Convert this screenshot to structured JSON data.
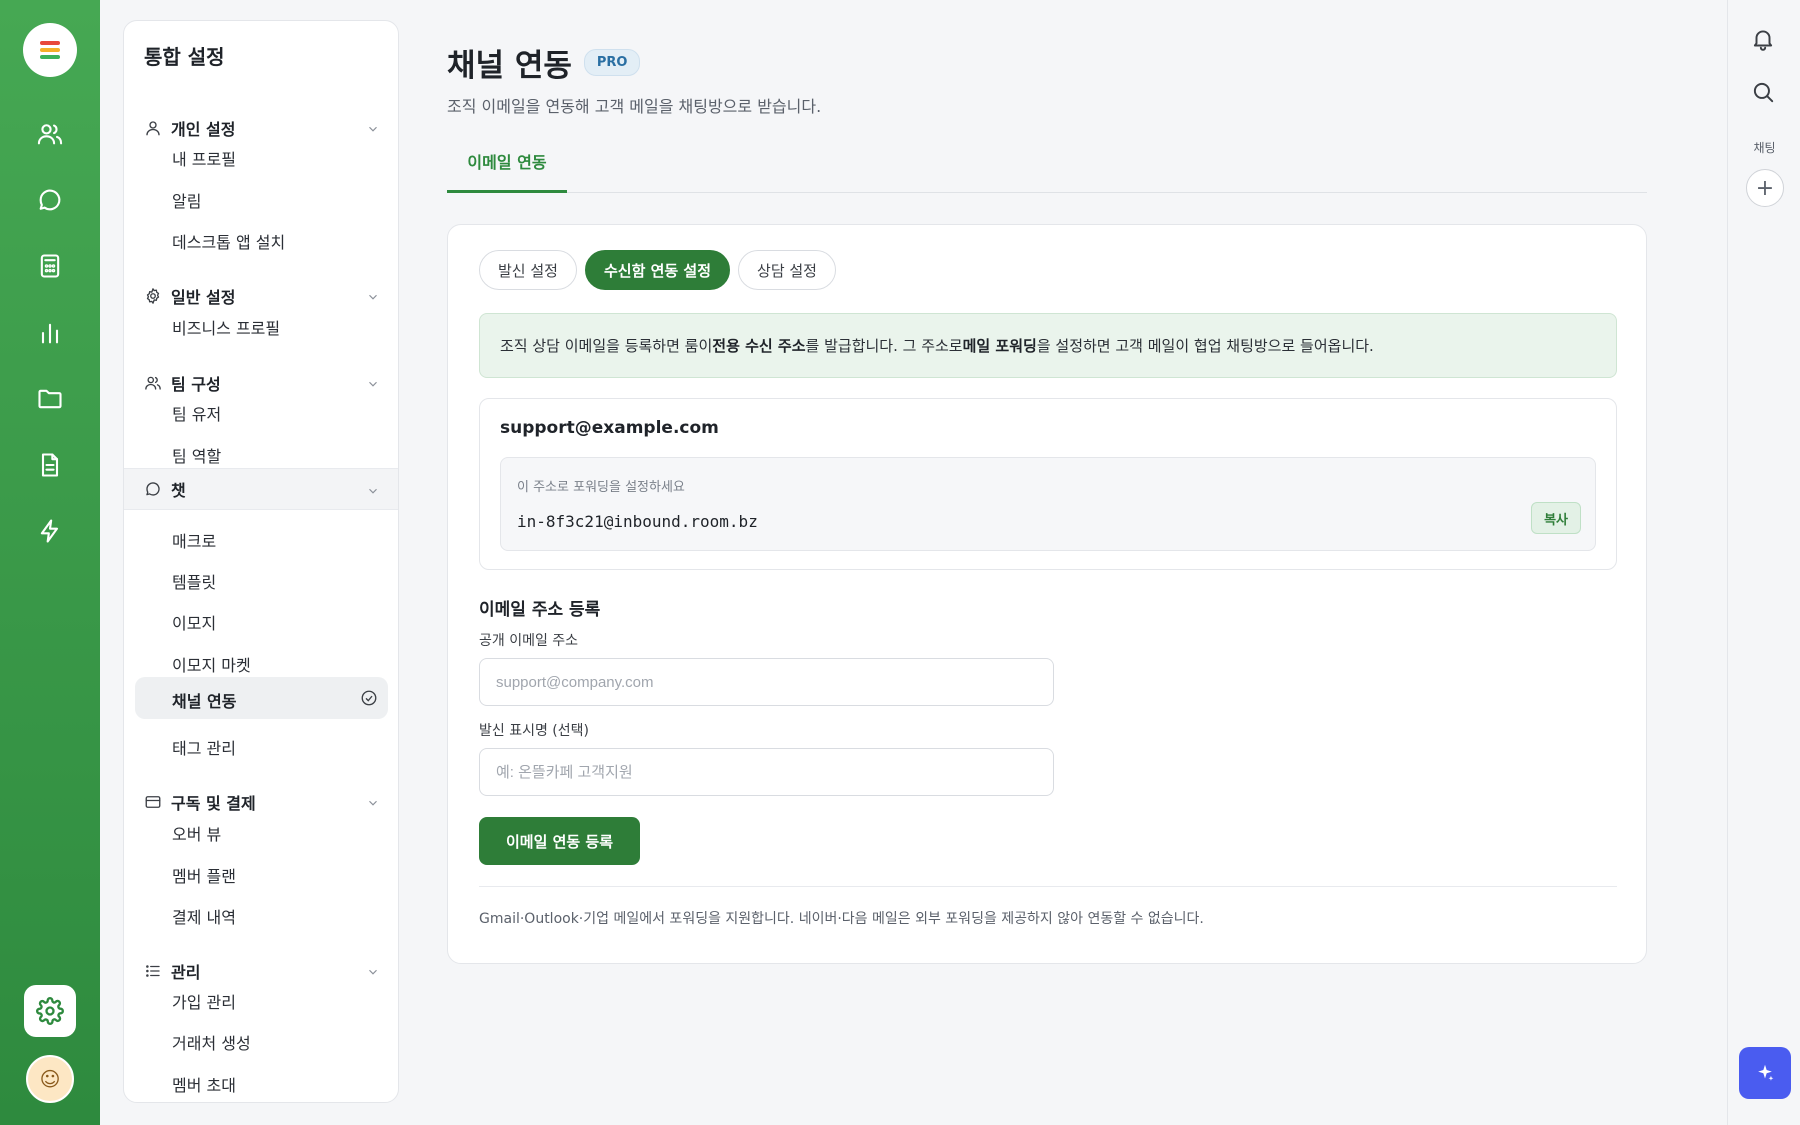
{
  "brand": {
    "accent": "#2e7d38",
    "rail_top": "#46a853",
    "rail_bottom": "#2e8a3e",
    "logo_bars": [
      "#e8483b",
      "#f4b02a",
      "#3bb15a"
    ]
  },
  "rail": {
    "icons": [
      "users-icon",
      "chat-icon",
      "calculator-icon",
      "bar-chart-icon",
      "folder-icon",
      "document-icon",
      "lightning-icon"
    ],
    "settings": "gear-icon",
    "avatar": "☺"
  },
  "sidebar": {
    "title": "통합 설정",
    "groups": [
      {
        "label": "개인 설정",
        "icon": "user-icon",
        "items": [
          "내 프로필",
          "알림",
          "데스크톱 앱 설치"
        ]
      },
      {
        "label": "일반 설정",
        "icon": "gear-icon",
        "items": [
          "비즈니스 프로필"
        ]
      },
      {
        "label": "팀 구성",
        "icon": "team-icon",
        "items": [
          "팀 유저",
          "팀 역할"
        ]
      },
      {
        "label": "챗",
        "icon": "chat-bubble-icon",
        "items": [
          "매크로",
          "템플릿",
          "이모지",
          "이모지 마켓",
          "채널 연동",
          "태그 관리"
        ]
      },
      {
        "label": "구독 및 결제",
        "icon": "credit-card-icon",
        "items": [
          "오버 뷰",
          "멤버 플랜",
          "결제 내역"
        ]
      },
      {
        "label": "관리",
        "icon": "list-icon",
        "items": [
          "가입 관리",
          "거래처 생성",
          "멤버 초대"
        ]
      }
    ]
  },
  "main": {
    "title": "채널 연동",
    "badge": "PRO",
    "subtitle": "조직 이메일을 연동해 고객 메일을 채팅방으로 받습니다.",
    "tab": "이메일 연동",
    "pills": [
      "발신 설정",
      "수신함 연동 설정",
      "상담 설정"
    ],
    "info": {
      "p1": "조직 상담 이메일을 등록하면 룸이 ",
      "b1": "전용 수신 주소",
      "p2": "를 발급합니다. 그 주소로 ",
      "b2": "메일 포워딩",
      "p3": "을 설정하면 고객 메일이 협업 채팅방으로 들어옵니다."
    },
    "address": {
      "email": "support@example.com",
      "forward_label": "이 주소로 포워딩을 설정하세요",
      "forward_value": "in-8f3c21@inbound.room.bz",
      "copy": "복사"
    },
    "register": {
      "title": "이메일 주소 등록",
      "email_label": "공개 이메일 주소",
      "email_placeholder": "support@company.com",
      "name_label": "발신 표시명 (선택)",
      "name_placeholder": "예: 온뜰카페 고객지원",
      "submit": "이메일 연동 등록"
    },
    "footnote": "Gmail·Outlook·기업 메일에서 포워딩을 지원합니다. 네이버·다음 메일은 외부 포워딩을 제공하지 않아 연동할 수 없습니다."
  },
  "rightbar": {
    "chat_label": "채팅",
    "plus": "+"
  }
}
